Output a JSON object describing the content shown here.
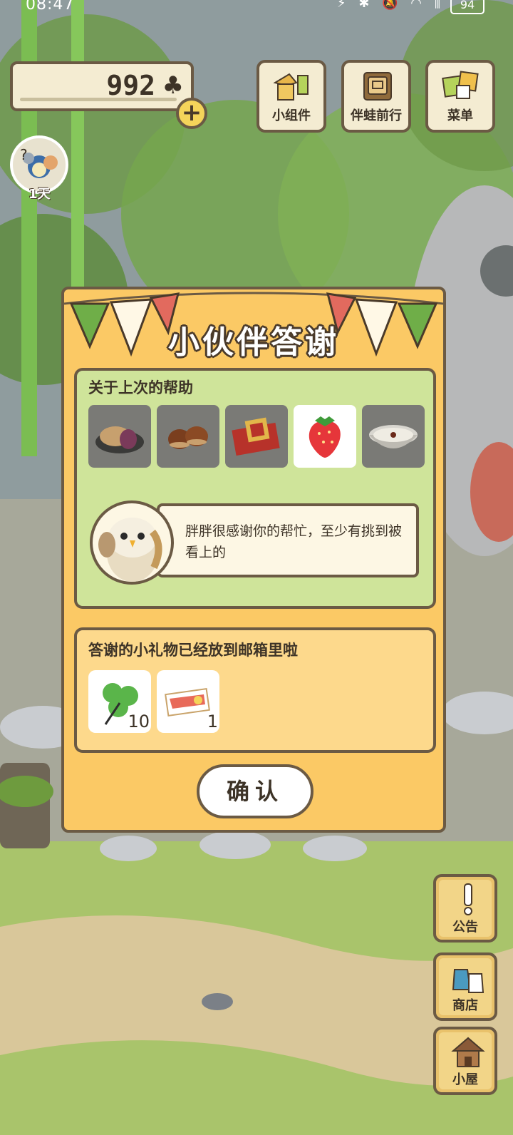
{
  "status_bar": {
    "time": "08:47",
    "icons": "⚡ ✱ 🔕 ◠ ⫼",
    "battery": "94"
  },
  "currency": {
    "clover_count": "992",
    "clover_icon": "♣",
    "plus_label": "+"
  },
  "top_menu": {
    "widgets_label": "小组件",
    "travel_label": "伴蛙前行",
    "menu_label": "菜单"
  },
  "day_badge": {
    "label": "1天"
  },
  "dialog": {
    "title": "小伙伴答谢",
    "help_section": {
      "title": "关于上次的帮助",
      "items": [
        {
          "icon": "mooncake-icon",
          "selected": false
        },
        {
          "icon": "chestnuts-icon",
          "selected": false
        },
        {
          "icon": "gift-box-icon",
          "selected": false
        },
        {
          "icon": "strawberry-icon",
          "selected": true
        },
        {
          "icon": "soup-bowl-icon",
          "selected": false
        }
      ],
      "message": "胖胖很感谢你的帮忙，至少有挑到被看上的",
      "speaker_icon": "owl-icon"
    },
    "gift_section": {
      "title": "答谢的小礼物已经放到邮箱里啦",
      "gifts": [
        {
          "icon": "clover-icon",
          "count": "10"
        },
        {
          "icon": "ticket-icon",
          "count": "1"
        }
      ]
    },
    "confirm_label": "确认"
  },
  "side_menu": {
    "notice_label": "公告",
    "shop_label": "商店",
    "house_label": "小屋"
  },
  "colors": {
    "dialog_bg": "#fbc965",
    "help_panel_bg": "#cfe49a",
    "gift_panel_bg": "#fdd98c",
    "outline": "#6b5a44"
  }
}
